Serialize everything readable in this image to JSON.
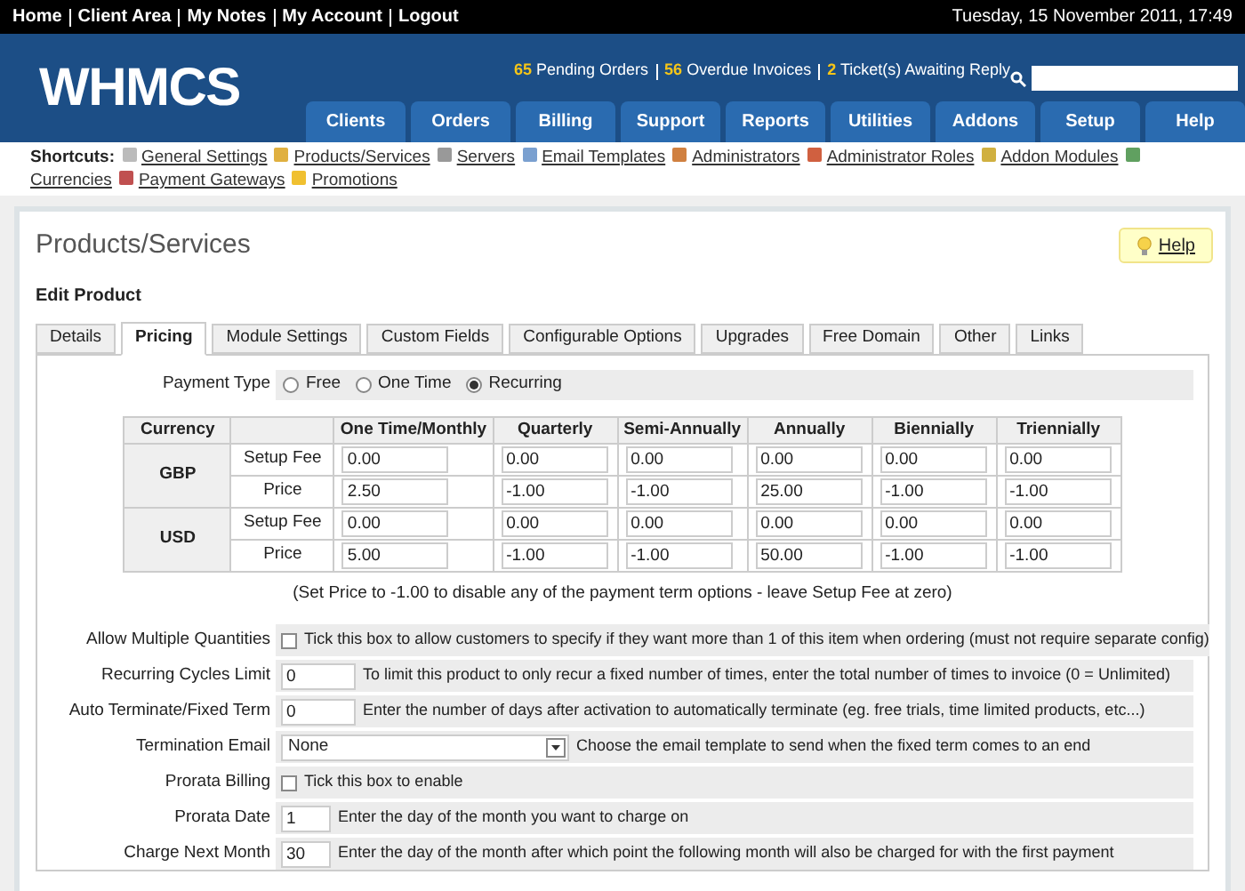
{
  "top_bar": {
    "links": [
      "Home",
      "Client Area",
      "My Notes",
      "My Account",
      "Logout"
    ],
    "datetime": "Tuesday, 15 November 2011, 17:49"
  },
  "header": {
    "logo": "WHMCS",
    "stats": [
      {
        "count": "65",
        "label": "Pending Orders"
      },
      {
        "count": "56",
        "label": "Overdue Invoices"
      },
      {
        "count": "2",
        "label": "Ticket(s) Awaiting Reply"
      }
    ],
    "nav": [
      "Clients",
      "Orders",
      "Billing",
      "Support",
      "Reports",
      "Utilities",
      "Addons",
      "Setup",
      "Help"
    ]
  },
  "shortcuts": {
    "label": "Shortcuts:",
    "items": [
      "General Settings",
      "Products/Services",
      "Servers",
      "Email Templates",
      "Administrators",
      "Administrator Roles",
      "Addon Modules",
      "Currencies",
      "Payment Gateways",
      "Promotions"
    ]
  },
  "page": {
    "title": "Products/Services",
    "help": "Help",
    "subtitle": "Edit Product"
  },
  "tabs": [
    {
      "label": "Details",
      "selected": false
    },
    {
      "label": "Pricing",
      "selected": true
    },
    {
      "label": "Module Settings",
      "selected": false
    },
    {
      "label": "Custom Fields",
      "selected": false
    },
    {
      "label": "Configurable Options",
      "selected": false
    },
    {
      "label": "Upgrades",
      "selected": false
    },
    {
      "label": "Free Domain",
      "selected": false
    },
    {
      "label": "Other",
      "selected": false
    },
    {
      "label": "Links",
      "selected": false
    }
  ],
  "payment_type": {
    "label": "Payment Type",
    "options": [
      {
        "label": "Free",
        "selected": false
      },
      {
        "label": "One Time",
        "selected": false
      },
      {
        "label": "Recurring",
        "selected": true
      }
    ]
  },
  "pricing_table": {
    "columns": [
      "Currency",
      "One Time/Monthly",
      "Quarterly",
      "Semi-Annually",
      "Annually",
      "Biennially",
      "Triennially"
    ],
    "currencies": [
      {
        "name": "GBP",
        "rows": [
          {
            "label": "Setup Fee",
            "values": [
              "0.00",
              "0.00",
              "0.00",
              "0.00",
              "0.00",
              "0.00"
            ]
          },
          {
            "label": "Price",
            "values": [
              "2.50",
              "-1.00",
              "-1.00",
              "25.00",
              "-1.00",
              "-1.00"
            ]
          }
        ]
      },
      {
        "name": "USD",
        "rows": [
          {
            "label": "Setup Fee",
            "values": [
              "0.00",
              "0.00",
              "0.00",
              "0.00",
              "0.00",
              "0.00"
            ]
          },
          {
            "label": "Price",
            "values": [
              "5.00",
              "-1.00",
              "-1.00",
              "50.00",
              "-1.00",
              "-1.00"
            ]
          }
        ]
      }
    ],
    "note": "(Set Price to -1.00 to disable any of the payment term options - leave Setup Fee at zero)"
  },
  "settings": [
    {
      "kind": "checkbox",
      "label": "Allow Multiple Quantities",
      "checked": false,
      "hint": "Tick this box to allow customers to specify if they want more than 1 of this item when ordering (must not require separate config)"
    },
    {
      "kind": "text",
      "label": "Recurring Cycles Limit",
      "value": "0",
      "hint": "To limit this product to only recur a fixed number of times, enter the total number of times to invoice (0 = Unlimited)"
    },
    {
      "kind": "text",
      "label": "Auto Terminate/Fixed Term",
      "value": "0",
      "hint": "Enter the number of days after activation to automatically terminate (eg. free trials, time limited products, etc...)"
    },
    {
      "kind": "select",
      "label": "Termination Email",
      "value": "None",
      "hint": "Choose the email template to send when the fixed term comes to an end"
    },
    {
      "kind": "checkbox",
      "label": "Prorata Billing",
      "checked": false,
      "hint": "Tick this box to enable"
    },
    {
      "kind": "short",
      "label": "Prorata Date",
      "value": "1",
      "hint": "Enter the day of the month you want to charge on"
    },
    {
      "kind": "short",
      "label": "Charge Next Month",
      "value": "30",
      "hint": "Enter the day of the month after which point the following month will also be charged for with the first payment"
    }
  ]
}
